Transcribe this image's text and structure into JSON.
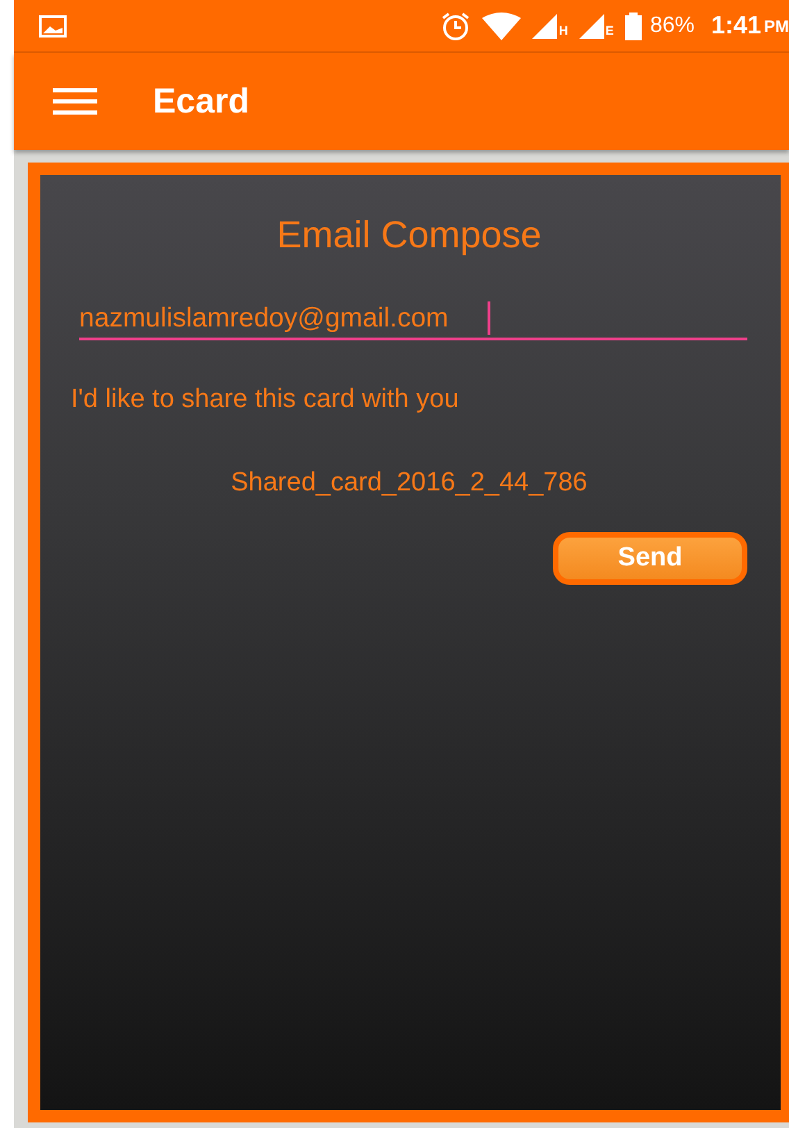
{
  "status_bar": {
    "network_1": "H",
    "network_2": "E",
    "battery": "86%",
    "time": "1:41",
    "period": "PM"
  },
  "app_bar": {
    "title": "Ecard"
  },
  "compose": {
    "title": "Email Compose",
    "email_field": {
      "value": "nazmulislamredoy@gmail.com",
      "focused": true
    },
    "message": "I'd like to share this card with you",
    "attachment": "Shared_card_2016_2_44_786",
    "send_button": "Send"
  }
}
